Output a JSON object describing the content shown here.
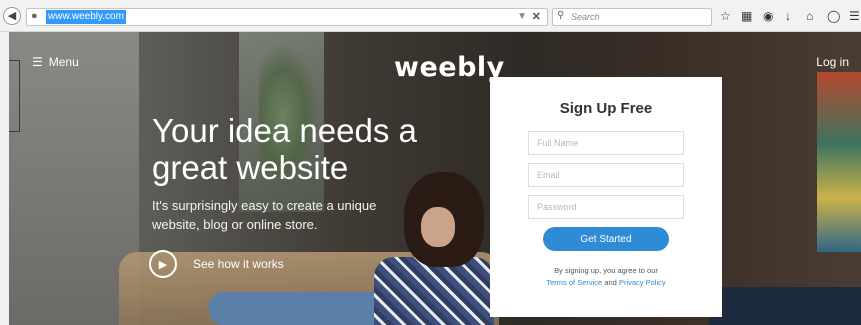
{
  "browser": {
    "url": "www.weebly.com",
    "search_placeholder": "Search",
    "icons": [
      "back-icon",
      "site-identity-icon",
      "dropmarker-icon",
      "close-icon",
      "search-icon",
      "star-icon",
      "reading-list-icon",
      "pocket-icon",
      "download-icon",
      "home-icon",
      "sync-icon",
      "menu-icon"
    ]
  },
  "site": {
    "menu_label": "Menu",
    "logo": "weebly",
    "login_label": "Log in",
    "headline": "Your idea needs a great website",
    "subheadline": "It's surprisingly easy to create a unique website, blog or online store.",
    "video_label": "See how it works",
    "signup": {
      "title": "Sign Up Free",
      "name_placeholder": "Full Name",
      "email_placeholder": "Email",
      "password_placeholder": "Password",
      "button_label": "Get Started",
      "terms_prefix": "By signing up, you agree to our",
      "terms_link": "Terms of Service",
      "terms_and": "and",
      "privacy_link": "Privacy Policy"
    }
  },
  "colors": {
    "accent": "#2f8bd6",
    "selection": "#3399ff"
  }
}
